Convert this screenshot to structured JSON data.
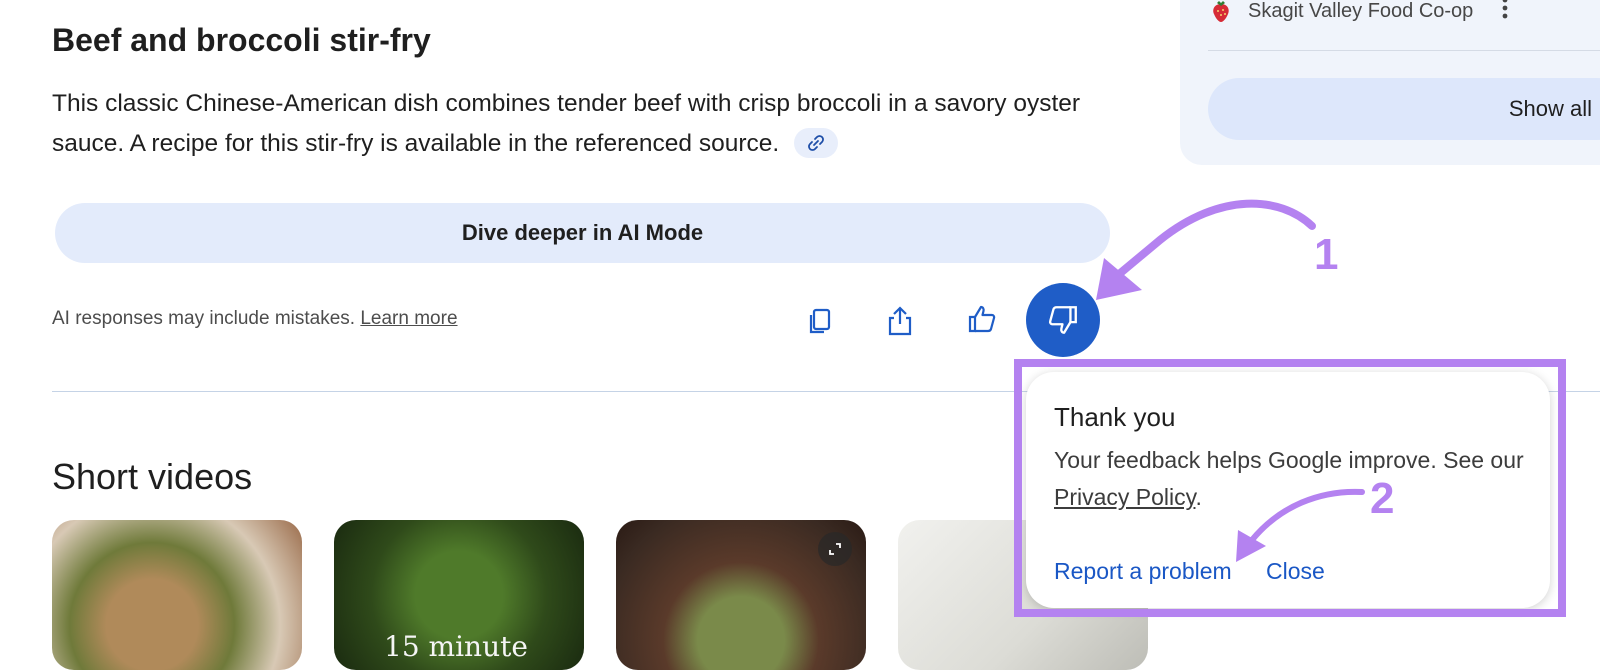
{
  "source_panel": {
    "source_name": "Skagit Valley Food Co-op",
    "more_icon": "more-vert-icon",
    "favicon": "strawberry-icon",
    "show_all_label": "Show all"
  },
  "answer": {
    "title": "Beef and broccoli stir-fry",
    "description": "This classic Chinese-American dish combines tender beef with crisp broccoli in a savory oyster sauce. A recipe for this stir-fry is available in the referenced source.",
    "link_icon": "link-icon",
    "dive_deeper_label": "Dive deeper in AI Mode",
    "disclaimer_text": "AI responses may include mistakes.",
    "learn_more_label": "Learn more",
    "actions": {
      "copy_icon": "copy-icon",
      "share_icon": "share-icon",
      "like_icon": "thumbs-up-icon",
      "dislike_icon": "thumbs-down-icon"
    }
  },
  "short_videos": {
    "heading": "Short videos",
    "thumbnail_2_caption": "15 minute"
  },
  "feedback_popup": {
    "title": "Thank you",
    "body_text": "Your feedback helps Google improve. See our",
    "privacy_link": "Privacy Policy",
    "body_end": ".",
    "report_label": "Report a problem",
    "close_label": "Close"
  },
  "annotations": {
    "marker_1": "1",
    "marker_2": "2",
    "highlight_color": "#b482f0"
  },
  "colors": {
    "accent_blue": "#1f5dc7",
    "link_blue": "#1a57c5",
    "panel_bg": "#f0f4fb",
    "button_bg": "#e3ebfb"
  }
}
